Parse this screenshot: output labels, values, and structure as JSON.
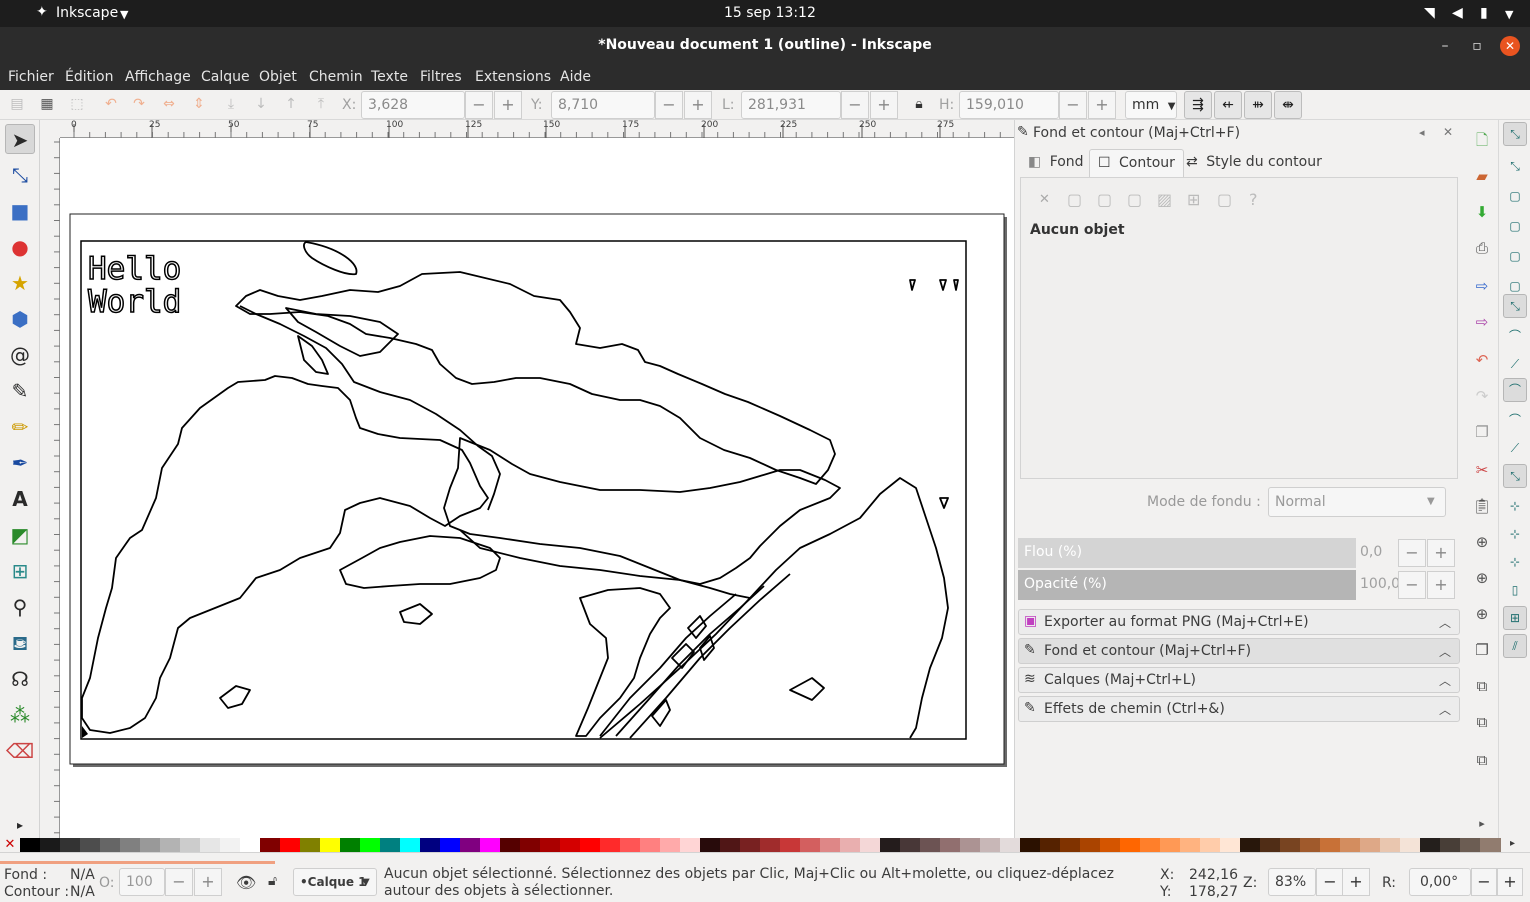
{
  "system_bar": {
    "app_name": "Inkscape",
    "clock": "15 sep  13:12"
  },
  "window": {
    "title": "*Nouveau document 1 (outline) - Inkscape"
  },
  "menu": [
    "Fichier",
    "Édition",
    "Affichage",
    "Calque",
    "Objet",
    "Chemin",
    "Texte",
    "Filtres",
    "Extensions",
    "Aide"
  ],
  "toolbar": {
    "x_label": "X:",
    "x_value": "3,628",
    "y_label": "Y:",
    "y_value": "8,710",
    "w_label": "L:",
    "w_value": "281,931",
    "h_label": "H:",
    "h_value": "159,010",
    "unit": "mm",
    "minus": "−",
    "plus": "+"
  },
  "ruler": {
    "top_ticks": [
      "0",
      "25",
      "50",
      "75",
      "100",
      "125",
      "150",
      "175",
      "200",
      "225",
      "250",
      "275"
    ]
  },
  "canvas": {
    "text_line1": "Hello",
    "text_line2": "World"
  },
  "panel": {
    "title": "Fond et contour (Maj+Ctrl+F)",
    "tabs": [
      "Fond",
      "Contour",
      "Style du contour"
    ],
    "no_object": "Aucun objet",
    "unknown_glyph": "?",
    "blend_label": "Mode de fondu :",
    "blend_value": "Normal",
    "blur_label": "Flou (%)",
    "blur_value": "0,0",
    "opacity_label": "Opacité (%)",
    "opacity_value": "100,0",
    "docked": [
      "Exporter au format PNG (Maj+Ctrl+E)",
      "Fond et contour (Maj+Ctrl+F)",
      "Calques (Maj+Ctrl+L)",
      "Effets de chemin (Ctrl+&)"
    ]
  },
  "status": {
    "fill_label": "Fond :",
    "fill_value": "N/A",
    "stroke_label": "Contour :",
    "stroke_value": "N/A",
    "opacity_label": "O:",
    "opacity_value": "100",
    "layer": "•Calque 1",
    "message": "Aucun objet sélectionné. Sélectionnez des objets par Clic, Maj+Clic ou Alt+molette, ou cliquez-déplacez autour des objets à sélectionner.",
    "x_label": "X:",
    "x_value": "242,16",
    "y_label": "Y:",
    "y_value": "178,27",
    "zoom_label": "Z:",
    "zoom_value": "83%",
    "rotate_label": "R:",
    "rotate_value": "0,00°"
  },
  "colors": {
    "topbar": "#1d1d1d",
    "titlebar": "#2c2c2c",
    "close_button": "#e95420",
    "palette": [
      "#000000",
      "#1a1a1a",
      "#333333",
      "#4d4d4d",
      "#666666",
      "#808080",
      "#999999",
      "#b3b3b3",
      "#cccccc",
      "#e6e6e6",
      "#f2f2f2",
      "#ffffff",
      "#800000",
      "#ff0000",
      "#808000",
      "#ffff00",
      "#008000",
      "#00ff00",
      "#008080",
      "#00ffff",
      "#000080",
      "#0000ff",
      "#800080",
      "#ff00ff",
      "#550000",
      "#800000",
      "#aa0000",
      "#d40000",
      "#ff0000",
      "#ff2a2a",
      "#ff5555",
      "#ff8080",
      "#ffaaaa",
      "#ffd5d5",
      "#280b0b",
      "#501616",
      "#782121",
      "#a02c2c",
      "#c83737",
      "#d35f5f",
      "#de8787",
      "#e9afaf",
      "#f4d7d7",
      "#241c1c",
      "#483737",
      "#6c5353",
      "#916f6f",
      "#ac9393",
      "#c8b7b7",
      "#e3dbdb",
      "#2b1100",
      "#552200",
      "#803300",
      "#aa4400",
      "#d45500",
      "#ff6600",
      "#ff7f2a",
      "#ff9955",
      "#ffb380",
      "#ffccaa",
      "#ffe6d5",
      "#28170b",
      "#502d16",
      "#784421",
      "#a05a2c",
      "#c87137",
      "#d38d5f",
      "#dea887",
      "#e9c6af",
      "#f4e3d7",
      "#241f1c",
      "#483e37",
      "#6c5d53",
      "#917c6f"
    ]
  }
}
